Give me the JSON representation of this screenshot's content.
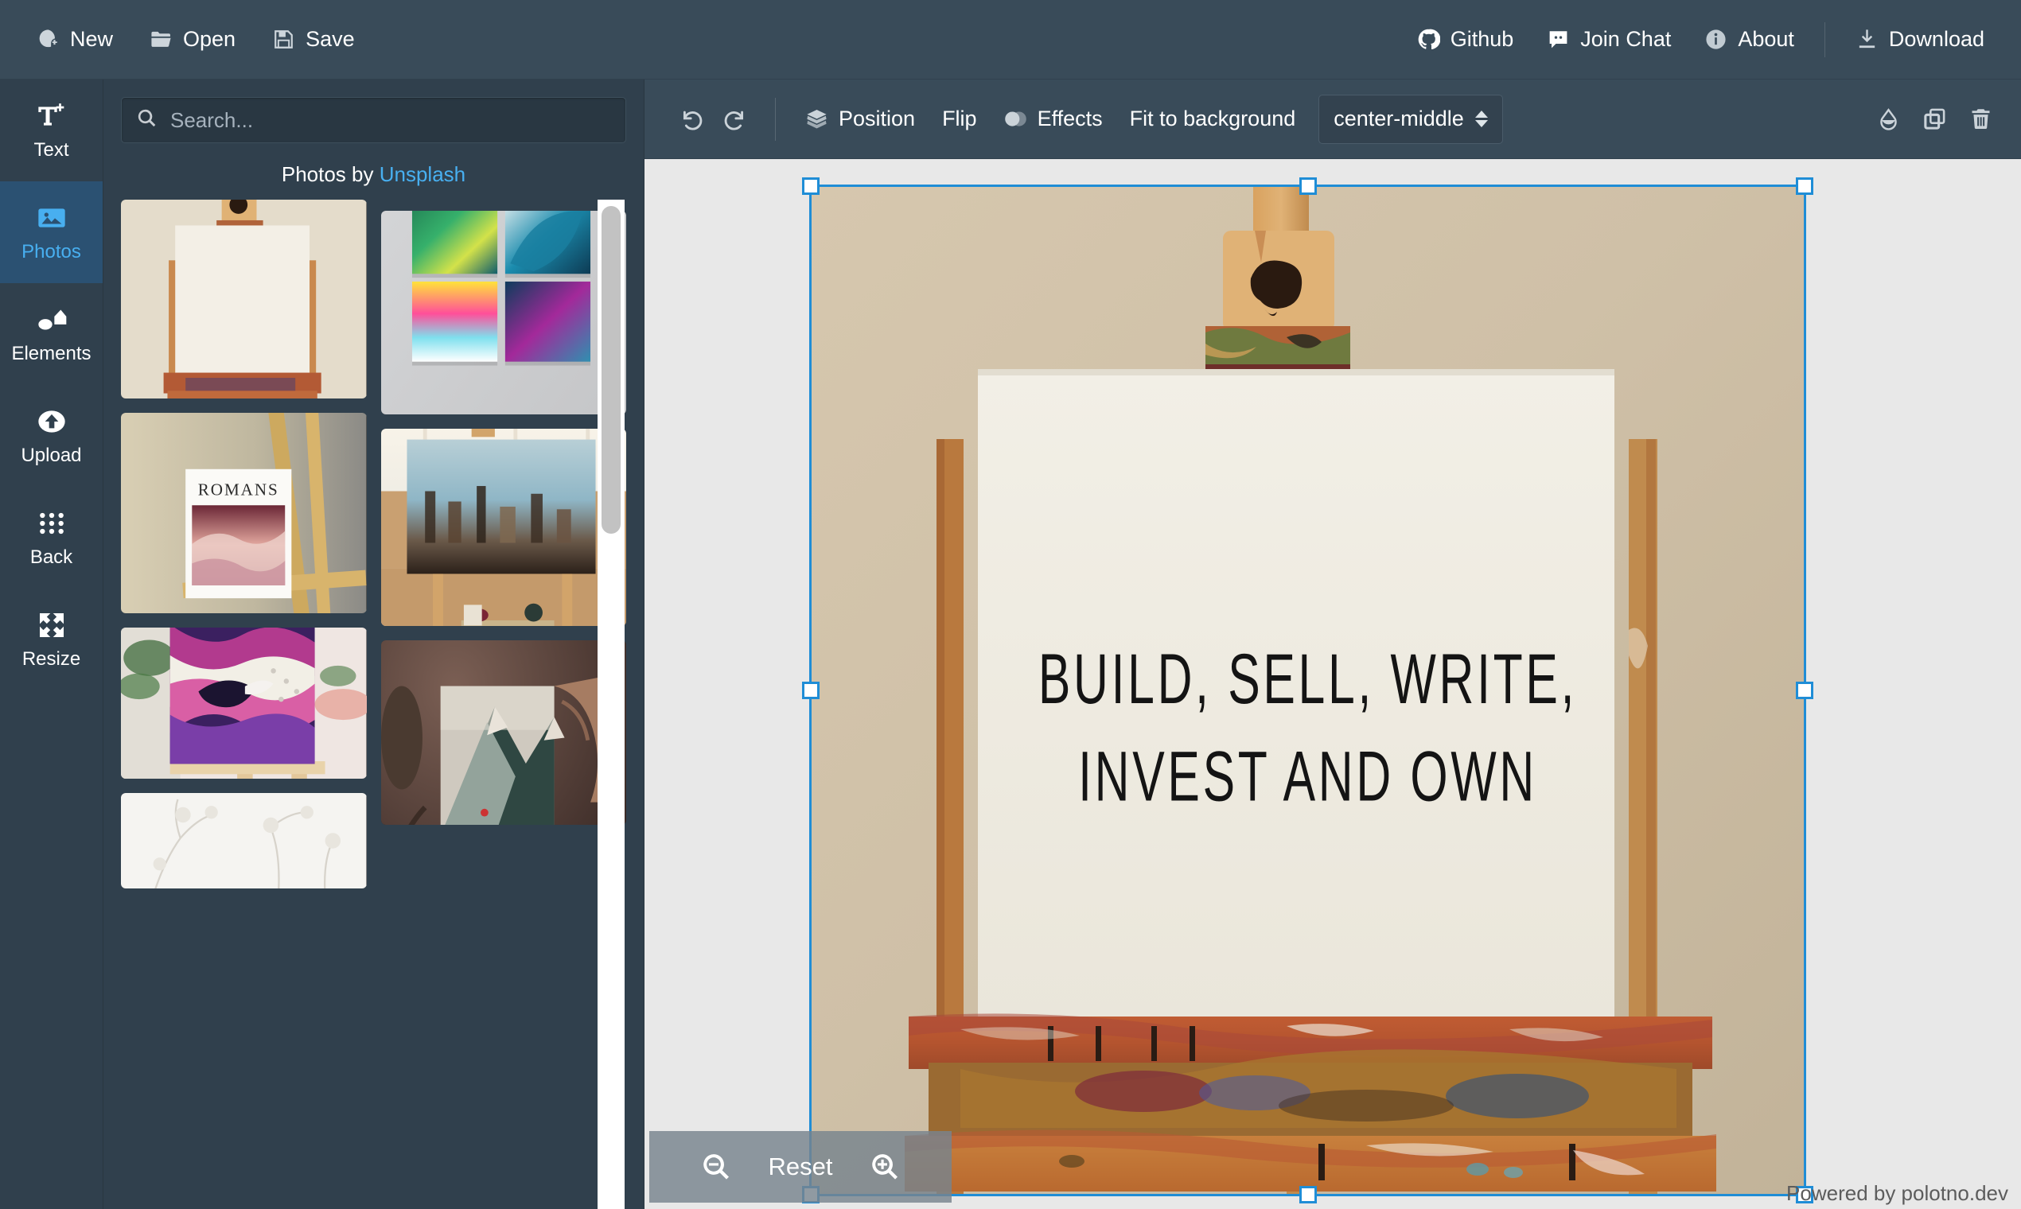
{
  "topbar": {
    "left_items": [
      {
        "label": "New",
        "icon": "new-file-icon"
      },
      {
        "label": "Open",
        "icon": "folder-open-icon"
      },
      {
        "label": "Save",
        "icon": "floppy-disk-icon"
      }
    ],
    "right_items": [
      {
        "label": "Github",
        "icon": "github-icon"
      },
      {
        "label": "Join Chat",
        "icon": "chat-icon"
      },
      {
        "label": "About",
        "icon": "info-icon"
      },
      {
        "label": "Download",
        "icon": "download-icon"
      }
    ]
  },
  "sidebar": {
    "items": [
      {
        "label": "Text",
        "icon": "text-box-icon",
        "active": false
      },
      {
        "label": "Photos",
        "icon": "image-icon",
        "active": true
      },
      {
        "label": "Elements",
        "icon": "shapes-icon",
        "active": false
      },
      {
        "label": "Upload",
        "icon": "upload-icon",
        "active": false
      },
      {
        "label": "Back",
        "icon": "grid-dots-icon",
        "active": false
      },
      {
        "label": "Resize",
        "icon": "expand-icon",
        "active": false
      }
    ]
  },
  "panel": {
    "search": {
      "value": "",
      "placeholder": "Search...",
      "icon": "search-icon"
    },
    "credit_prefix": "Photos by ",
    "credit_link": "Unsplash",
    "thumbnails": [
      {
        "name": "blank-canvas-on-wooden-easel"
      },
      {
        "name": "four-abstract-paintings-on-grey-wall"
      },
      {
        "name": "romans-poster-on-gold-easel"
      },
      {
        "name": "abstract-cityscape-painting-in-studio"
      },
      {
        "name": "purple-whale-painting-on-mini-easel"
      },
      {
        "name": "mountain-painting-held-by-hand"
      },
      {
        "name": "white-winter-branches-photo"
      }
    ]
  },
  "toolbar": {
    "undo_icon": "undo-icon",
    "redo_icon": "redo-icon",
    "buttons": [
      {
        "label": "Position",
        "icon": "layers-icon"
      },
      {
        "label": "Flip",
        "icon": ""
      },
      {
        "label": "Effects",
        "icon": "contrast-icon"
      },
      {
        "label": "Fit to background",
        "icon": ""
      }
    ],
    "crop_select": {
      "value": "center-middle"
    },
    "right_icons": [
      {
        "name": "opacity-droplet-icon"
      },
      {
        "name": "duplicate-icon"
      },
      {
        "name": "trash-icon"
      }
    ]
  },
  "stage": {
    "canvas_text_lines": [
      "BUILD, SELL, WRITE,",
      "INVEST AND OWN"
    ],
    "zoom_controls": {
      "out_icon": "zoom-out-icon",
      "reset_label": "Reset",
      "in_icon": "zoom-in-icon"
    },
    "powered_by": "Powered by polotno.dev"
  },
  "colors": {
    "topbar_bg": "#394b59",
    "rail_bg": "#30404d",
    "panel_bg": "#30404d",
    "active_bg": "#2b5172",
    "accent": "#48aff0",
    "selection_blue": "#1f8dd6",
    "stage_bg": "#e8e8e8"
  }
}
